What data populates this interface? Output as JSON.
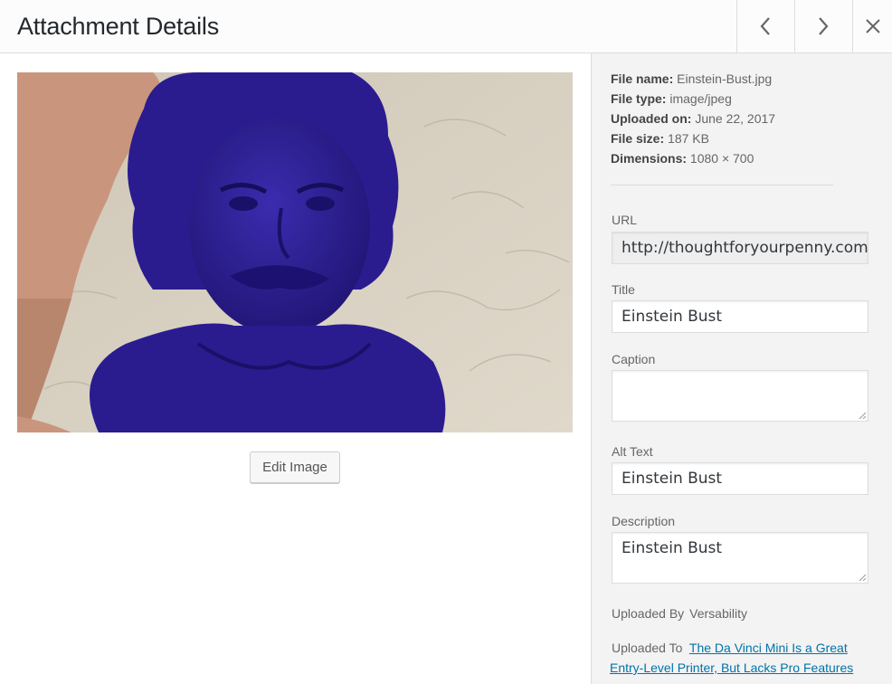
{
  "header": {
    "title": "Attachment Details",
    "prev_icon": "chevron-left-icon",
    "next_icon": "chevron-right-icon",
    "close_icon": "close-icon"
  },
  "media": {
    "edit_button_label": "Edit Image"
  },
  "details": {
    "file_name_label": "File name:",
    "file_name": "Einstein-Bust.jpg",
    "file_type_label": "File type:",
    "file_type": "image/jpeg",
    "uploaded_on_label": "Uploaded on:",
    "uploaded_on": "June 22, 2017",
    "file_size_label": "File size:",
    "file_size": "187 KB",
    "dimensions_label": "Dimensions:",
    "dimensions": "1080 × 700"
  },
  "form": {
    "url_label": "URL",
    "url_value": "http://thoughtforyourpenny.com",
    "title_label": "Title",
    "title_value": "Einstein Bust",
    "caption_label": "Caption",
    "caption_value": "",
    "alt_label": "Alt Text",
    "alt_value": "Einstein Bust",
    "description_label": "Description",
    "description_value": "Einstein Bust"
  },
  "uploaded_by": {
    "label": "Uploaded By",
    "value": "Versability"
  },
  "uploaded_to": {
    "label": "Uploaded To",
    "link_text": "The Da Vinci Mini Is a Great Entry-Level Printer, But Lacks Pro Features"
  },
  "colors": {
    "accent_link": "#0073aa",
    "bust_blue": "#2e1f9a",
    "wall": "#d9d2c4"
  }
}
